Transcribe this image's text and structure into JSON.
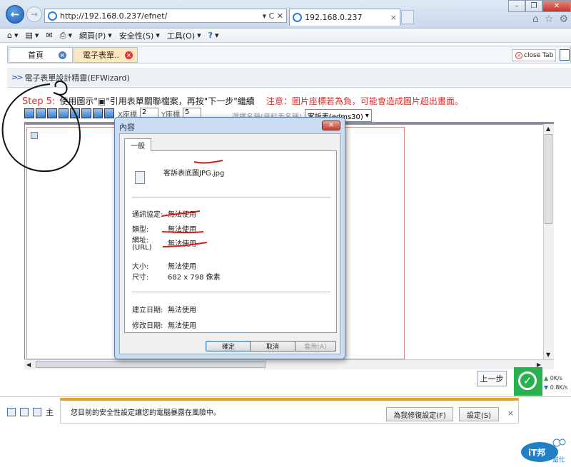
{
  "browser": {
    "url": "http://192.168.0.237/efnet/",
    "address_actions": "▾ C ✕",
    "tab_title": "192.168.0.237",
    "tab_close": "×",
    "window_controls": [
      "–",
      "❐",
      "✕"
    ],
    "right_icons": [
      "home-icon",
      "star-icon",
      "gear-icon"
    ],
    "command_bar": [
      {
        "label": "",
        "icon": "home-icon"
      },
      {
        "label": "",
        "icon": "feeds-icon"
      },
      {
        "label": "",
        "icon": "mail-icon"
      },
      {
        "label": "",
        "icon": "print-icon"
      },
      {
        "label": "網頁(P)",
        "icon": ""
      },
      {
        "label": "安全性(S)",
        "icon": ""
      },
      {
        "label": "工具(O)",
        "icon": ""
      },
      {
        "label": "",
        "icon": "help-icon"
      }
    ]
  },
  "page": {
    "tabs": [
      {
        "label": "首頁"
      },
      {
        "label": "電子表單.."
      }
    ],
    "close_tab_label": "close Tab",
    "wizard_title": "電子表單設計精靈(EFWizard)",
    "step_label": "Step 5:",
    "step_text": "使用圖示\"▣\"引用表單關聯檔案，再按\"下一步\"繼續",
    "step_note": "注意：圖片座標若為負，可能會造成圖片超出畫面。",
    "x_label": "X座標",
    "x_value": "2",
    "y_label": "Y座標",
    "y_value": "5",
    "select_label": "選擇名稱(資料表名稱)",
    "select_value": "客訴表(edms30)",
    "prev_button": "上一步",
    "bottom_text": "主"
  },
  "speed": {
    "up": "0K/s",
    "down": "0.8K/s"
  },
  "security_bar": {
    "message": "您目前的安全性設定讓您的電腦暴露在風險中。",
    "fix_button": "為我修復設定(F)",
    "settings_button": "設定(S)",
    "close": "×"
  },
  "dialog": {
    "title": "內容",
    "close": "✕",
    "tab": "一般",
    "filename": "客訴表底圖JPG.jpg",
    "protocol_label": "通訊協定:",
    "protocol_value": "無法使用",
    "type_label": "類型:",
    "type_value": "無法使用",
    "address_label": "網址:",
    "address_label2": "(URL)",
    "address_value": "無法使用",
    "size_label": "大小:",
    "size_value": "無法使用",
    "dimensions_label": "尺寸:",
    "dimensions_value": "682 x 798 像素",
    "created_label": "建立日期:",
    "created_value": "無法使用",
    "modified_label": "修改日期:",
    "modified_value": "無法使用",
    "ok_button": "確定",
    "cancel_button": "取消",
    "apply_button": "套用(A)"
  },
  "logo": {
    "text": "iT邦",
    "sub": "幫忙"
  },
  "colors": {
    "accent_red": "#d9302c",
    "tab_active": "#fde6c2",
    "security_warn": "#e2a227",
    "speed_ok": "#28b14c"
  }
}
